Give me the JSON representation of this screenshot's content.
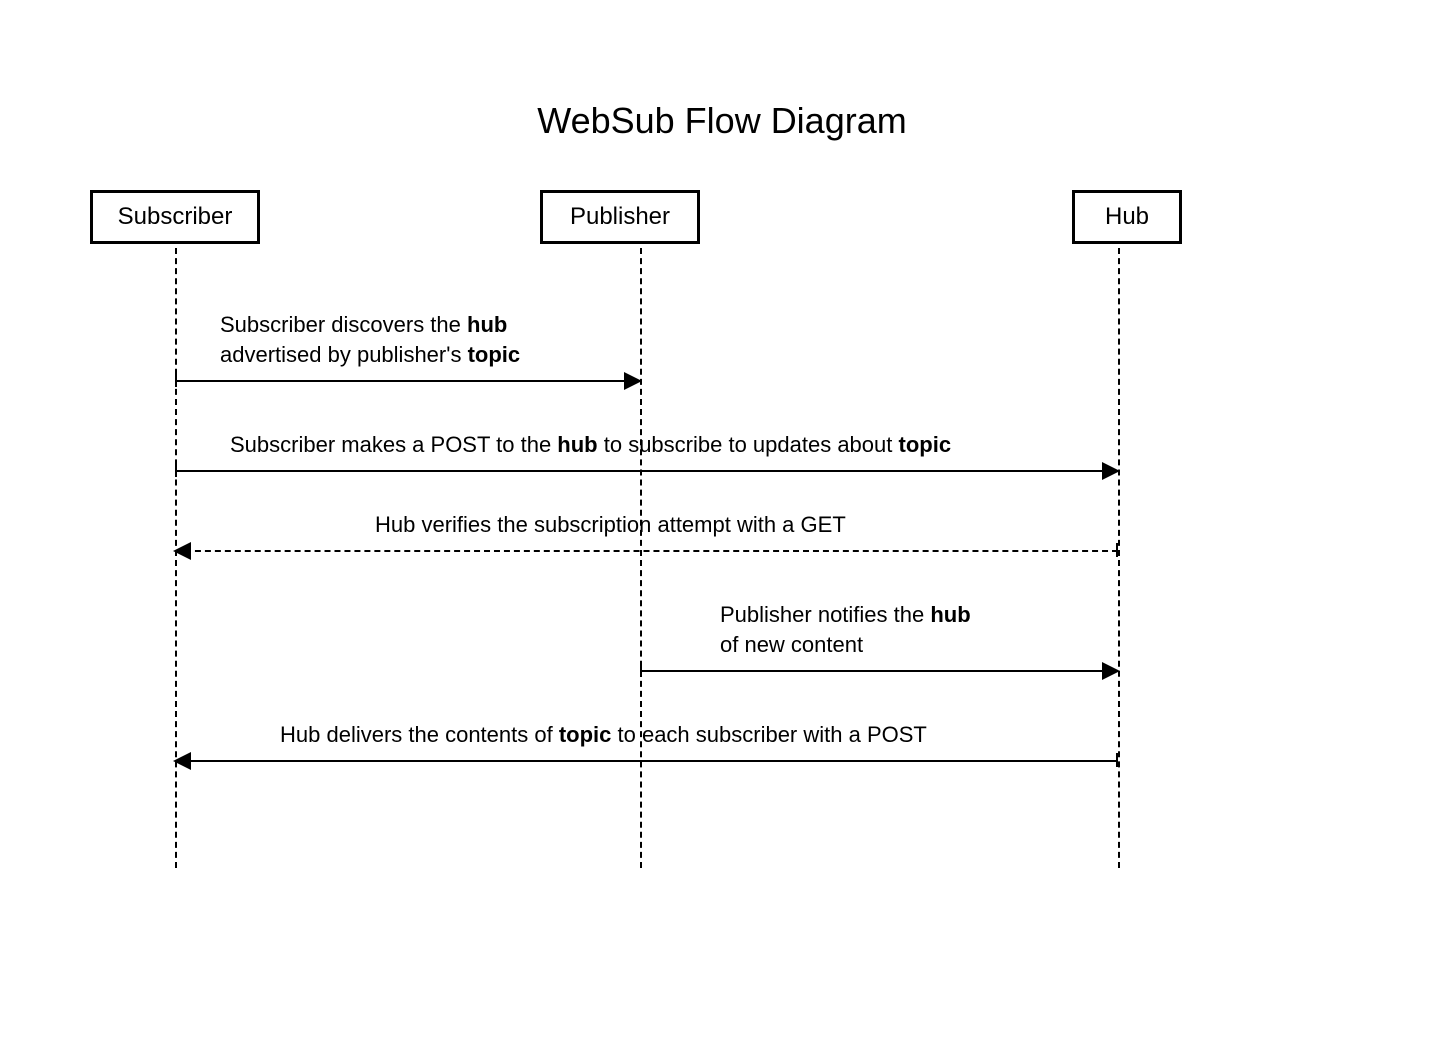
{
  "title": "WebSub Flow Diagram",
  "actors": {
    "subscriber": "Subscriber",
    "publisher": "Publisher",
    "hub": "Hub"
  },
  "messages": {
    "m1": {
      "pre1": "Subscriber discovers the ",
      "bold1": "hub",
      "pre2": "advertised by publisher's ",
      "bold2": "topic"
    },
    "m2": {
      "pre1": "Subscriber makes a POST to the ",
      "bold1": "hub",
      "mid": " to subscribe to updates about ",
      "bold2": "topic"
    },
    "m3": {
      "text": "Hub verifies the subscription attempt with a GET"
    },
    "m4": {
      "pre1": "Publisher notifies the ",
      "bold1": "hub",
      "line2": "of new content"
    },
    "m5": {
      "pre1": "Hub delivers the contents of ",
      "bold1": "topic",
      "post": " to each subscriber with a POST"
    }
  }
}
